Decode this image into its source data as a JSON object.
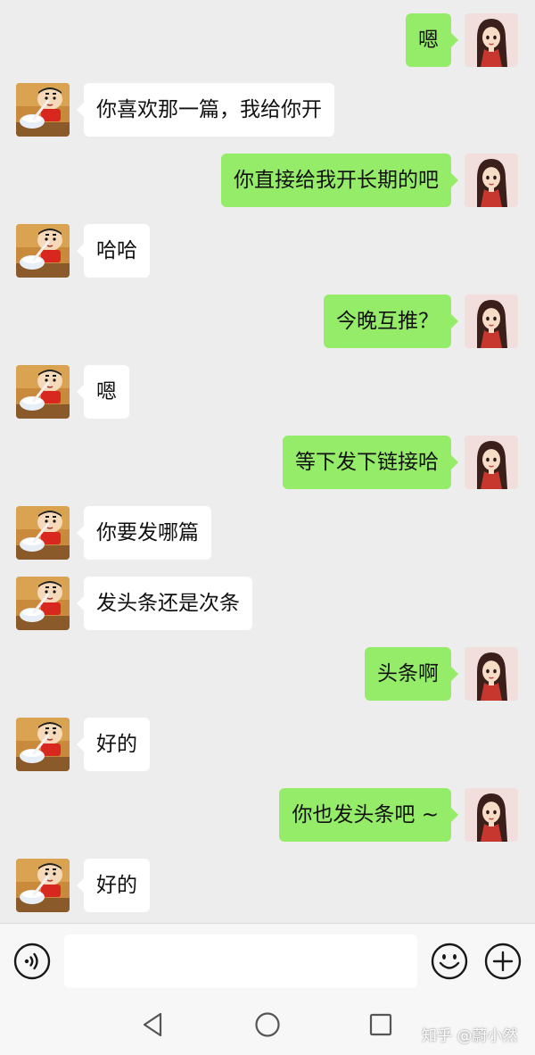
{
  "colors": {
    "background": "#ededed",
    "self_bubble": "#95ec69",
    "other_bubble": "#ffffff",
    "input_bar": "#f7f7f7"
  },
  "messages": [
    {
      "side": "right",
      "text": "嗯"
    },
    {
      "side": "left",
      "text": "你喜欢那一篇，我给你开"
    },
    {
      "side": "right",
      "text": "你直接给我开长期的吧"
    },
    {
      "side": "left",
      "text": "哈哈"
    },
    {
      "side": "right",
      "text": "今晚互推？"
    },
    {
      "side": "left",
      "text": "嗯"
    },
    {
      "side": "right",
      "text": "等下发下链接哈"
    },
    {
      "side": "left",
      "text": "你要发哪篇"
    },
    {
      "side": "left",
      "text": "发头条还是次条"
    },
    {
      "side": "right",
      "text": "头条啊"
    },
    {
      "side": "left",
      "text": "好的"
    },
    {
      "side": "right",
      "text": "你也发头条吧 ~"
    },
    {
      "side": "left",
      "text": "好的"
    }
  ],
  "input_bar": {
    "voice_icon": "voice-icon",
    "emoji_icon": "emoji-icon",
    "plus_icon": "plus-icon",
    "text_value": ""
  },
  "nav_bar": {
    "back_icon": "back-triangle-icon",
    "home_icon": "home-circle-icon",
    "recent_icon": "recent-square-icon"
  },
  "watermark": "知乎 @蔚小然"
}
